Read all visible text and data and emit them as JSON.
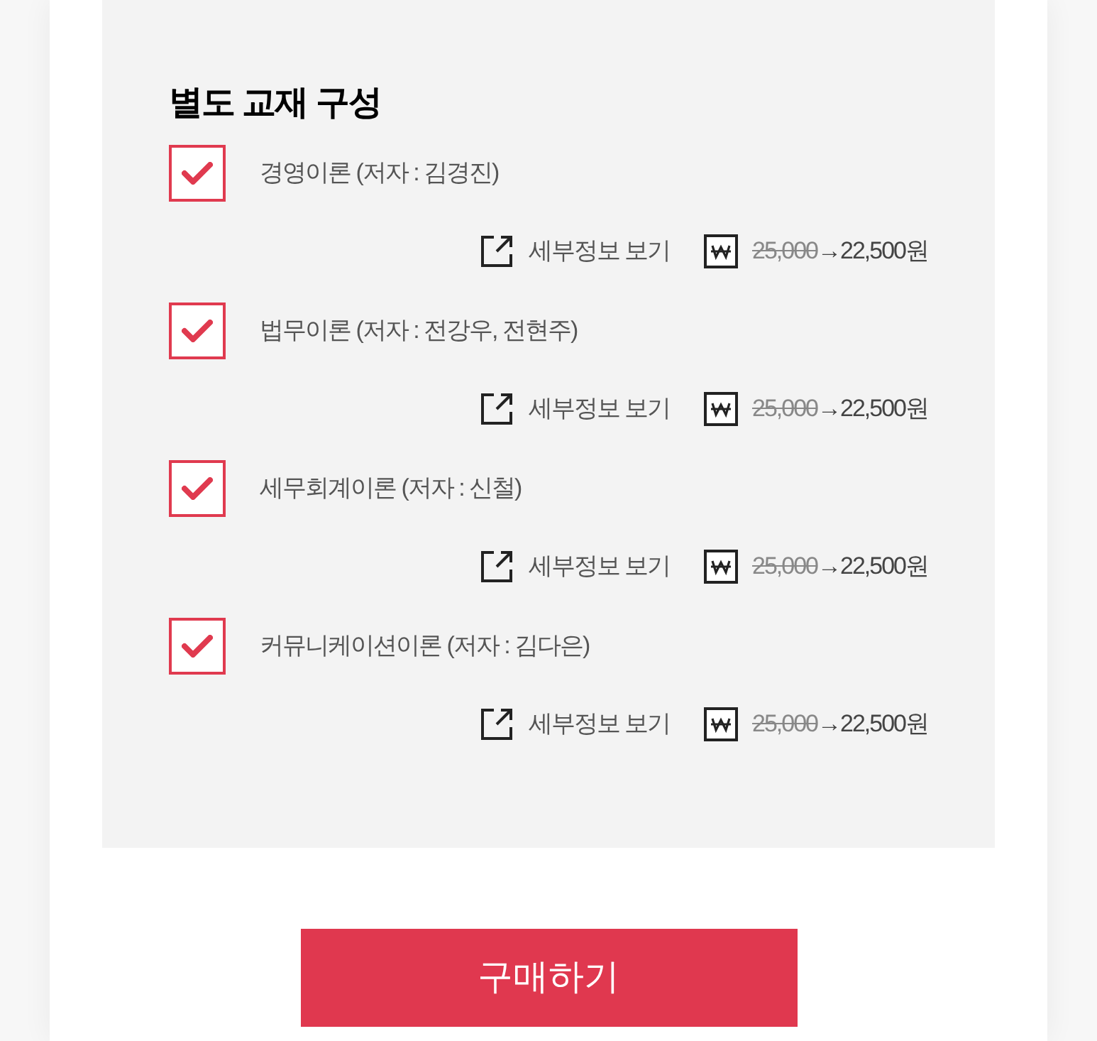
{
  "section_title": "별도 교재 구성",
  "books": [
    {
      "title": "경영이론 (저자 : 김경진)",
      "checked": true,
      "details_link": "세부정보 보기",
      "original_price": "25,000",
      "sale_price": "→22,500원"
    },
    {
      "title": "법무이론 (저자 : 전강우, 전현주)",
      "checked": true,
      "details_link": "세부정보 보기",
      "original_price": "25,000",
      "sale_price": "→22,500원"
    },
    {
      "title": "세무회계이론 (저자 : 신철)",
      "checked": true,
      "details_link": "세부정보 보기",
      "original_price": "25,000",
      "sale_price": "→22,500원"
    },
    {
      "title": "커뮤니케이션이론 (저자 : 김다은)",
      "checked": true,
      "details_link": "세부정보 보기",
      "original_price": "25,000",
      "sale_price": "→22,500원"
    }
  ],
  "buy_button": "구매하기"
}
